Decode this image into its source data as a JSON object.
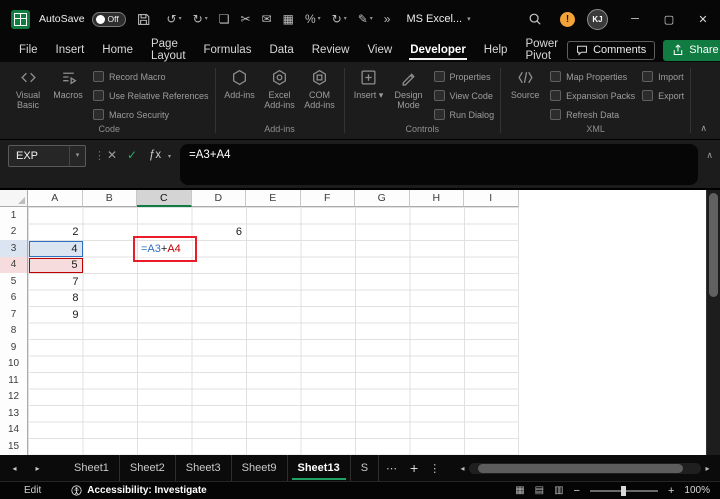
{
  "titlebar": {
    "autosave": {
      "label": "AutoSave",
      "state": "Off"
    },
    "app_title": "MS Excel...",
    "avatar_initials": "KJ",
    "qat_icons": [
      {
        "name": "undo-icon",
        "glyph": "↺",
        "dropdown": true
      },
      {
        "name": "redo-icon",
        "glyph": "↻",
        "dropdown": true
      },
      {
        "name": "copy-icon",
        "glyph": "❏",
        "dropdown": false
      },
      {
        "name": "cut-icon",
        "glyph": "✂",
        "dropdown": false
      },
      {
        "name": "mail-icon",
        "glyph": "✉",
        "dropdown": false
      },
      {
        "name": "table-icon",
        "glyph": "▦",
        "dropdown": false
      },
      {
        "name": "percent-icon",
        "glyph": "%",
        "dropdown": true
      },
      {
        "name": "refresh-icon",
        "glyph": "↻",
        "dropdown": true
      },
      {
        "name": "draw-icon",
        "glyph": "✎",
        "dropdown": true
      },
      {
        "name": "more-commands-icon",
        "glyph": "»",
        "dropdown": false
      }
    ],
    "window": {
      "minimize": "─",
      "maximize": "▢",
      "close": "✕"
    }
  },
  "menubar": {
    "items": [
      "File",
      "Insert",
      "Home",
      "Page Layout",
      "Formulas",
      "Data",
      "Review",
      "View",
      "Developer",
      "Help",
      "Power Pivot"
    ],
    "active_item": "Developer",
    "comments": "Comments",
    "share": "Share"
  },
  "ribbon": {
    "groups": [
      {
        "label": "Code",
        "large_buttons": [
          {
            "label": "Visual Basic",
            "icon": "visual-basic-icon"
          },
          {
            "label": "Macros",
            "icon": "macros-icon"
          }
        ],
        "small_buttons": [
          {
            "label": "Record Macro",
            "icon": "record-macro-icon"
          },
          {
            "label": "Use Relative References",
            "icon": "relative-references-icon"
          },
          {
            "label": "Macro Security",
            "icon": "macro-security-icon"
          }
        ]
      },
      {
        "label": "Add-ins",
        "large_buttons": [
          {
            "label": "Add-ins",
            "icon": "add-ins-icon"
          },
          {
            "label": "Excel Add-ins",
            "icon": "excel-add-ins-icon"
          },
          {
            "label": "COM Add-ins",
            "icon": "com-add-ins-icon"
          }
        ],
        "small_buttons": []
      },
      {
        "label": "Controls",
        "large_buttons": [
          {
            "label": "Insert",
            "icon": "insert-control-icon",
            "dropdown": true
          },
          {
            "label": "Design Mode",
            "icon": "design-mode-icon"
          }
        ],
        "small_buttons": [
          {
            "label": "Properties",
            "icon": "properties-icon"
          },
          {
            "label": "View Code",
            "icon": "view-code-icon"
          },
          {
            "label": "Run Dialog",
            "icon": "run-dialog-icon"
          }
        ]
      },
      {
        "label": "XML",
        "large_buttons": [
          {
            "label": "Source",
            "icon": "source-icon"
          }
        ],
        "small_buttons": [
          {
            "label": "Map Properties",
            "icon": "map-properties-icon"
          },
          {
            "label": "Expansion Packs",
            "icon": "expansion-packs-icon"
          },
          {
            "label": "Refresh Data",
            "icon": "refresh-data-icon"
          }
        ],
        "small_buttons_2": [
          {
            "label": "Import",
            "icon": "import-icon"
          },
          {
            "label": "Export",
            "icon": "export-icon"
          }
        ]
      }
    ]
  },
  "formula_bar": {
    "name_box_value": "EXP",
    "formula_value": "=A3+A4"
  },
  "grid": {
    "column_headers": [
      "A",
      "B",
      "C",
      "D",
      "E",
      "F",
      "G",
      "H",
      "I"
    ],
    "row_headers": [
      "1",
      "2",
      "3",
      "4",
      "5",
      "6",
      "7",
      "8",
      "9",
      "10",
      "11",
      "12",
      "13",
      "14",
      "15"
    ],
    "active_column": "C",
    "cells": [
      {
        "ref": "A2",
        "col": "A",
        "row": "2",
        "value": "2"
      },
      {
        "ref": "A3",
        "col": "A",
        "row": "3",
        "value": "4",
        "highlight": "blue"
      },
      {
        "ref": "A4",
        "col": "A",
        "row": "4",
        "value": "5",
        "highlight": "red"
      },
      {
        "ref": "A5",
        "col": "A",
        "row": "5",
        "value": "7"
      },
      {
        "ref": "A6",
        "col": "A",
        "row": "6",
        "value": "8"
      },
      {
        "ref": "A7",
        "col": "A",
        "row": "7",
        "value": "9"
      },
      {
        "ref": "D2",
        "col": "D",
        "row": "2",
        "value": "6"
      }
    ],
    "editing_cell": {
      "ref": "C3",
      "formula_parts": [
        {
          "text": "=A3",
          "color": "#2f6fc0"
        },
        {
          "text": "+",
          "color": "#1b1b1b"
        },
        {
          "text": "A4",
          "color": "#c00000"
        }
      ]
    }
  },
  "sheet_tabs": {
    "tabs": [
      "Sheet1",
      "Sheet2",
      "Sheet3",
      "Sheet9",
      "Sheet13",
      "S"
    ],
    "active_tab": "Sheet13"
  },
  "status_bar": {
    "mode": "Edit",
    "accessibility_text": "Accessibility: Investigate",
    "zoom_level": "100%"
  },
  "colors": {
    "accent_green": "#107c41",
    "tab_accent_green": "#21a366",
    "share_green": "#107c41",
    "ref_blue": "#2f6fc0",
    "ref_blue_fill": "#dbe5f1",
    "ref_red": "#c00000",
    "ref_red_fill": "#f6dcdc",
    "annotation_red": "#ea1c2c",
    "warning_amber": "#f2a33a"
  }
}
